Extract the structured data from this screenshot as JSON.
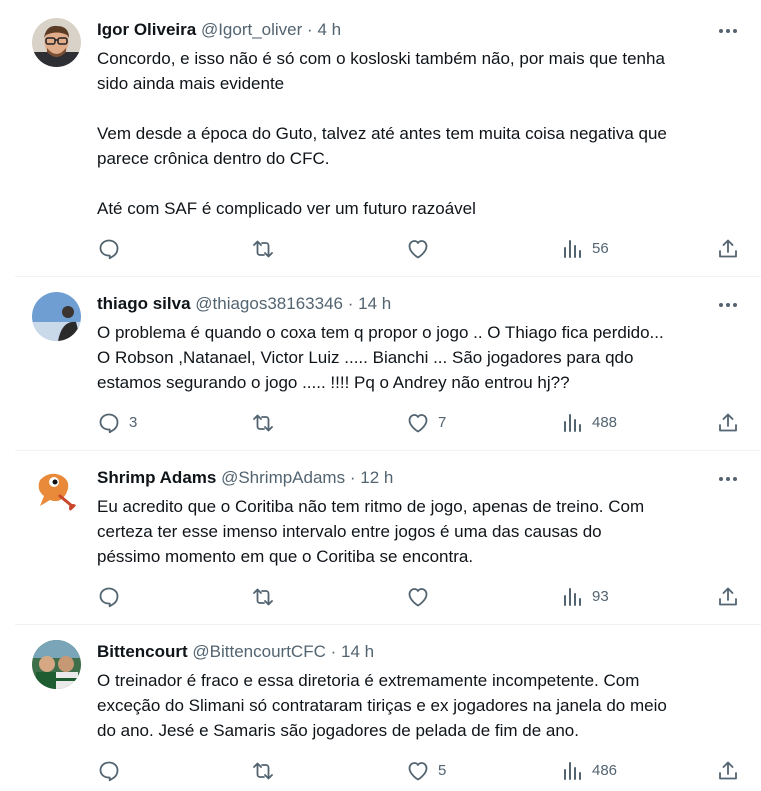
{
  "tweets": [
    {
      "name": "Igor Oliveira",
      "handle": "@Igort_oliver",
      "dot": "·",
      "time": "4 h",
      "lines": [
        "Concordo, e isso não é só com o kosloski também não, por mais que tenha",
        "sido ainda mais evidente",
        "",
        "Vem desde a época do Guto, talvez até antes tem muita coisa negativa que",
        "parece crônica dentro do CFC.",
        "",
        "Até com SAF é complicado ver um futuro razoável"
      ],
      "replies": "",
      "retweets": "",
      "likes": "",
      "views": "56"
    },
    {
      "name": "thiago silva",
      "handle": "@thiagos38163346",
      "dot": "·",
      "time": "14 h",
      "lines": [
        "O problema é quando o coxa tem q propor o jogo .. O Thiago fica perdido...",
        "O Robson ,Natanael, Victor Luiz ..... Bianchi ... São jogadores para qdo",
        "estamos segurando o jogo ..... !!!! Pq o Andrey não entrou hj??"
      ],
      "replies": "3",
      "retweets": "",
      "likes": "7",
      "views": "488"
    },
    {
      "name": "Shrimp Adams",
      "handle": "@ShrimpAdams",
      "dot": "·",
      "time": "12 h",
      "lines": [
        "Eu acredito que o Coritiba não tem ritmo de jogo, apenas de treino. Com",
        "certeza ter esse imenso intervalo entre jogos é uma das causas do",
        "péssimo momento em que o Coritiba se encontra."
      ],
      "replies": "",
      "retweets": "",
      "likes": "",
      "views": "93"
    },
    {
      "name": "Bittencourt",
      "handle": "@BittencourtCFC",
      "dot": "·",
      "time": "14 h",
      "lines": [
        "O treinador é fraco e essa diretoria é extremamente incompetente. Com",
        "exceção do Slimani só contrataram tiriças e ex jogadores na janela do meio",
        "do ano. Jesé e Samaris são jogadores de pelada de fim de ano."
      ],
      "replies": "",
      "retweets": "",
      "likes": "5",
      "views": "486"
    }
  ],
  "icons": {
    "reply": "reply-icon",
    "retweet": "retweet-icon",
    "like": "like-icon",
    "views": "views-icon",
    "share": "share-icon",
    "more": "more-icon"
  },
  "colors": {
    "text": "#0f1419",
    "secondary": "#536471",
    "divider": "#eff3f4"
  }
}
